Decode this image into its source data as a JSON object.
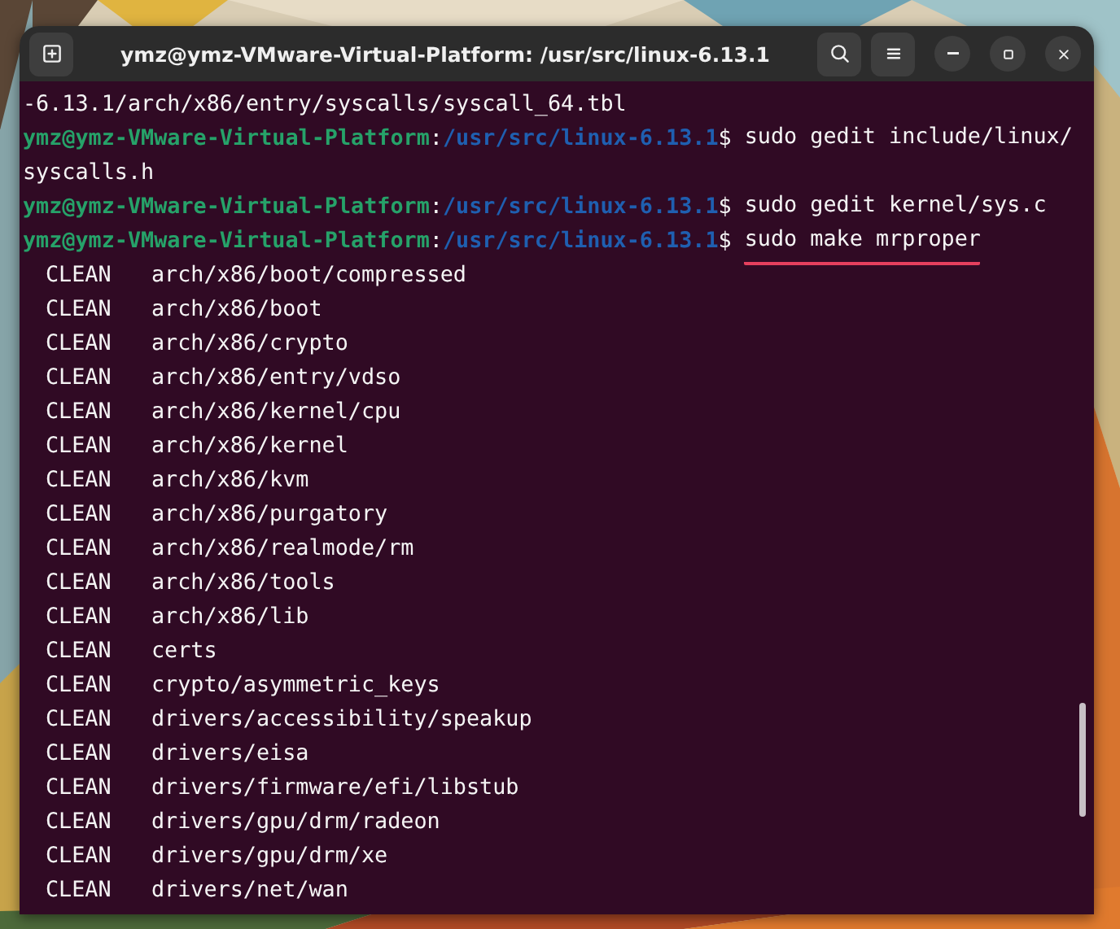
{
  "window": {
    "title": "ymz@ymz-VMware-Virtual-Platform: /usr/src/linux-6.13.1"
  },
  "terminal": {
    "lines": [
      {
        "kind": "output",
        "text": "-6.13.1/arch/x86/entry/syscalls/syscall_64.tbl"
      },
      {
        "kind": "prompt",
        "user": "ymz@ymz-VMware-Virtual-Platform",
        "separator": ":",
        "path": "/usr/src/linux-6.13.1",
        "symbol": "$",
        "command": "sudo gedit include/linux/",
        "underlined": false
      },
      {
        "kind": "output",
        "text": "syscalls.h"
      },
      {
        "kind": "prompt",
        "user": "ymz@ymz-VMware-Virtual-Platform",
        "separator": ":",
        "path": "/usr/src/linux-6.13.1",
        "symbol": "$",
        "command": "sudo gedit kernel/sys.c",
        "underlined": false
      },
      {
        "kind": "prompt",
        "user": "ymz@ymz-VMware-Virtual-Platform",
        "separator": ":",
        "path": "/usr/src/linux-6.13.1",
        "symbol": "$",
        "command": "sudo make mrproper",
        "underlined": true
      },
      {
        "kind": "clean",
        "tag": "CLEAN",
        "path": "arch/x86/boot/compressed"
      },
      {
        "kind": "clean",
        "tag": "CLEAN",
        "path": "arch/x86/boot"
      },
      {
        "kind": "clean",
        "tag": "CLEAN",
        "path": "arch/x86/crypto"
      },
      {
        "kind": "clean",
        "tag": "CLEAN",
        "path": "arch/x86/entry/vdso"
      },
      {
        "kind": "clean",
        "tag": "CLEAN",
        "path": "arch/x86/kernel/cpu"
      },
      {
        "kind": "clean",
        "tag": "CLEAN",
        "path": "arch/x86/kernel"
      },
      {
        "kind": "clean",
        "tag": "CLEAN",
        "path": "arch/x86/kvm"
      },
      {
        "kind": "clean",
        "tag": "CLEAN",
        "path": "arch/x86/purgatory"
      },
      {
        "kind": "clean",
        "tag": "CLEAN",
        "path": "arch/x86/realmode/rm"
      },
      {
        "kind": "clean",
        "tag": "CLEAN",
        "path": "arch/x86/tools"
      },
      {
        "kind": "clean",
        "tag": "CLEAN",
        "path": "arch/x86/lib"
      },
      {
        "kind": "clean",
        "tag": "CLEAN",
        "path": "certs"
      },
      {
        "kind": "clean",
        "tag": "CLEAN",
        "path": "crypto/asymmetric_keys"
      },
      {
        "kind": "clean",
        "tag": "CLEAN",
        "path": "drivers/accessibility/speakup"
      },
      {
        "kind": "clean",
        "tag": "CLEAN",
        "path": "drivers/eisa"
      },
      {
        "kind": "clean",
        "tag": "CLEAN",
        "path": "drivers/firmware/efi/libstub"
      },
      {
        "kind": "clean",
        "tag": "CLEAN",
        "path": "drivers/gpu/drm/radeon"
      },
      {
        "kind": "clean",
        "tag": "CLEAN",
        "path": "drivers/gpu/drm/xe"
      },
      {
        "kind": "clean",
        "tag": "CLEAN",
        "path": "drivers/net/wan"
      }
    ]
  }
}
